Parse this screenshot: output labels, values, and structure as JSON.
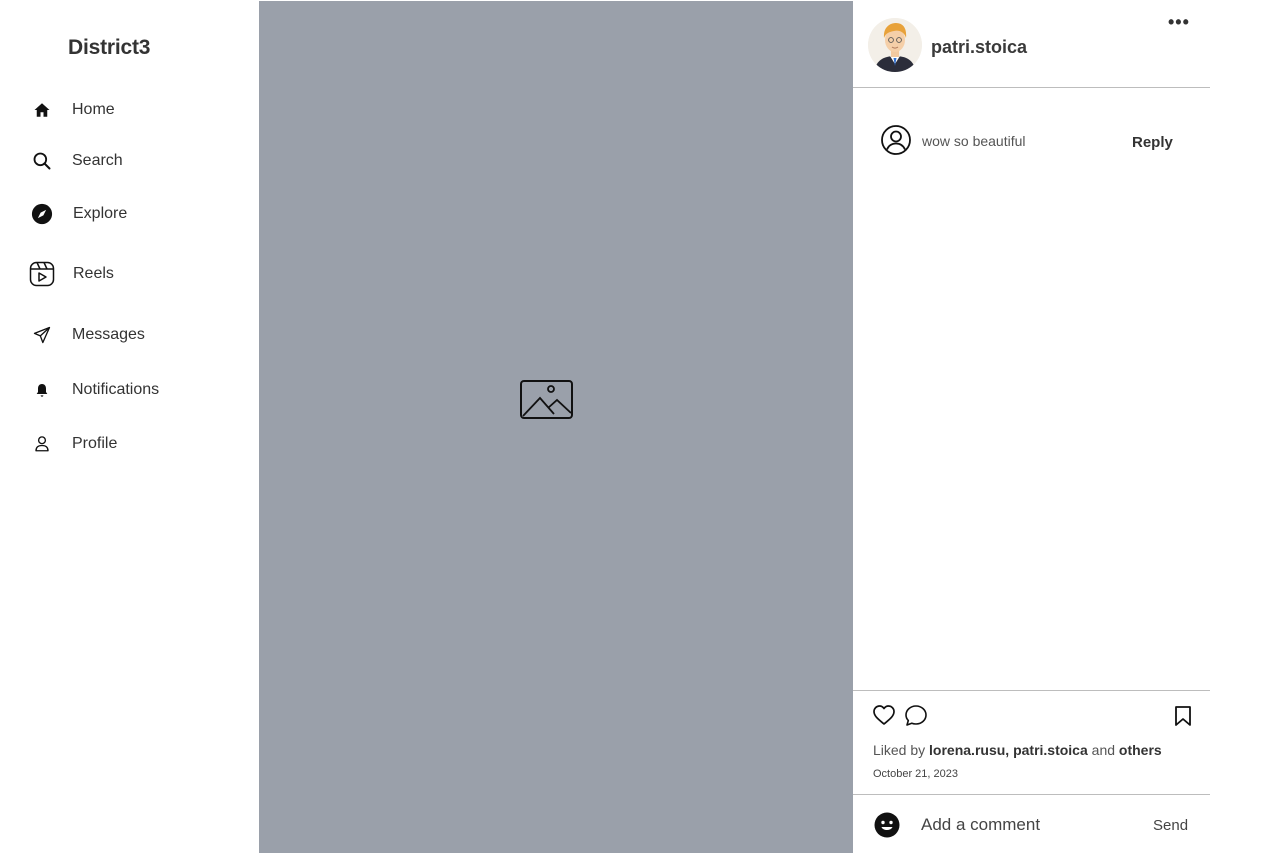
{
  "sidebar": {
    "brand": "District3",
    "items": [
      {
        "label": "Home",
        "icon": "home-icon"
      },
      {
        "label": "Search",
        "icon": "search-icon"
      },
      {
        "label": "Explore",
        "icon": "compass-icon"
      },
      {
        "label": "Reels",
        "icon": "reels-icon"
      },
      {
        "label": "Messages",
        "icon": "send-icon"
      },
      {
        "label": "Notifications",
        "icon": "bell-icon"
      },
      {
        "label": "Profile",
        "icon": "user-icon"
      }
    ]
  },
  "media": {
    "background": "#9aa0aa",
    "icon": "image-placeholder-icon"
  },
  "post": {
    "username": "patri.stoica",
    "more_label": "•••",
    "comments": [
      {
        "text": "wow so beautiful",
        "reply_label": "Reply",
        "icon": "user-circle-icon"
      }
    ],
    "liked_prefix": "Liked by",
    "liked_users": "lorena.rusu, patri.stoica",
    "liked_and": "and",
    "liked_others": "others",
    "date": "October 21, 2023",
    "add_comment_placeholder": "Add a comment",
    "send_label": "Send"
  }
}
